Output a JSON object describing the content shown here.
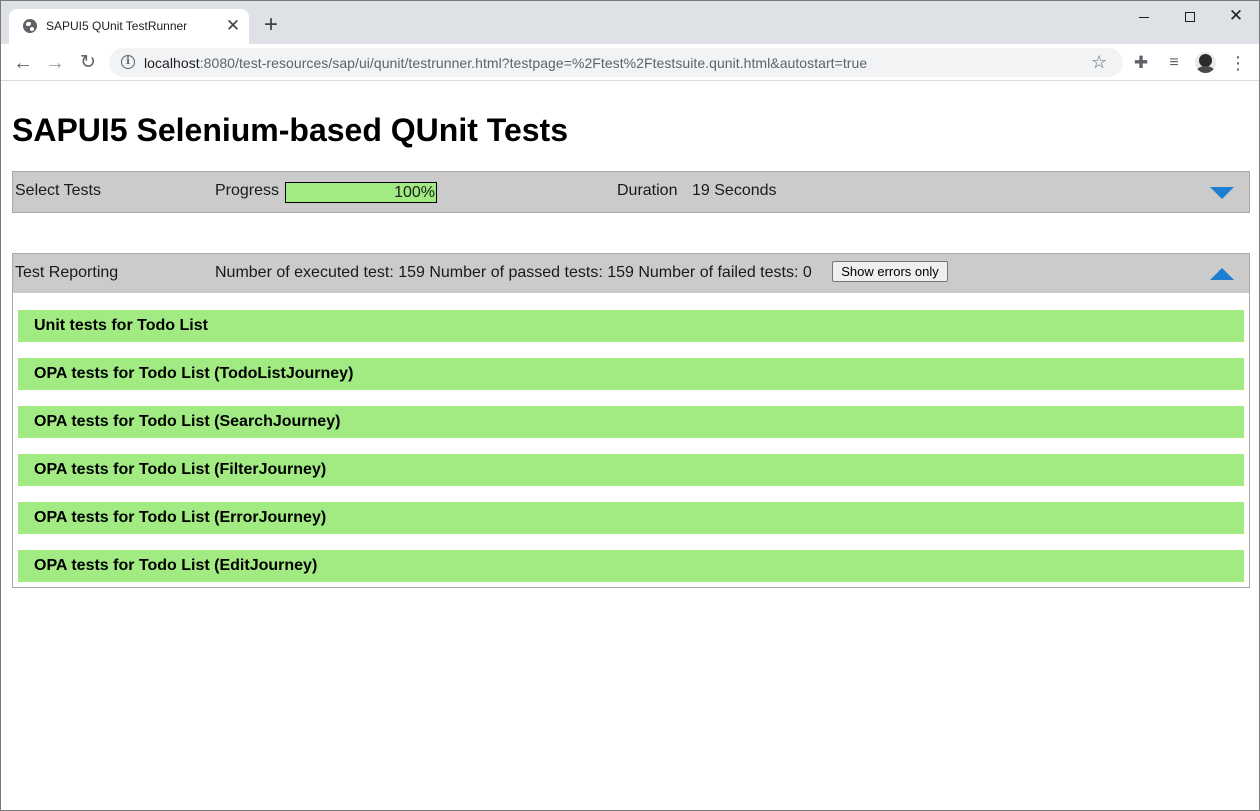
{
  "browser": {
    "tab_title": "SAPUI5 QUnit TestRunner",
    "tab_close": "✕",
    "new_tab": "+",
    "url_host": "localhost",
    "url_rest": ":8080/test-resources/sap/ui/qunit/testrunner.html?testpage=%2Ftest%2Ftestsuite.qunit.html&autostart=true",
    "back": "←",
    "forward": "→",
    "reload": "↻",
    "star": "☆",
    "extensions": "✚",
    "media": "≡",
    "menu": "⋮",
    "info": "i",
    "win_close": "✕"
  },
  "page": {
    "title": "SAPUI5 Selenium-based QUnit Tests"
  },
  "select_bar": {
    "select_tests_label": "Select Tests",
    "progress_label": "Progress",
    "progress_value": "100%",
    "progress_fraction": 1.0,
    "duration_label": "Duration",
    "duration_value": "19 Seconds",
    "arrow_color": "#1e7fd0"
  },
  "report_bar": {
    "label": "Test Reporting",
    "summary": "Number of executed test: 159 Number of passed tests: 159 Number of failed tests: 0",
    "show_errors_button": "Show errors only"
  },
  "results": [
    {
      "label": "Unit tests for Todo List",
      "status": "passed"
    },
    {
      "label": "OPA tests for Todo List (TodoListJourney)",
      "status": "passed"
    },
    {
      "label": "OPA tests for Todo List (SearchJourney)",
      "status": "passed"
    },
    {
      "label": "OPA tests for Todo List (FilterJourney)",
      "status": "passed"
    },
    {
      "label": "OPA tests for Todo List (ErrorJourney)",
      "status": "passed"
    },
    {
      "label": "OPA tests for Todo List (EditJourney)",
      "status": "passed"
    }
  ],
  "colors": {
    "passed": "#a2eb82",
    "bar_background": "#cbcbcb"
  }
}
